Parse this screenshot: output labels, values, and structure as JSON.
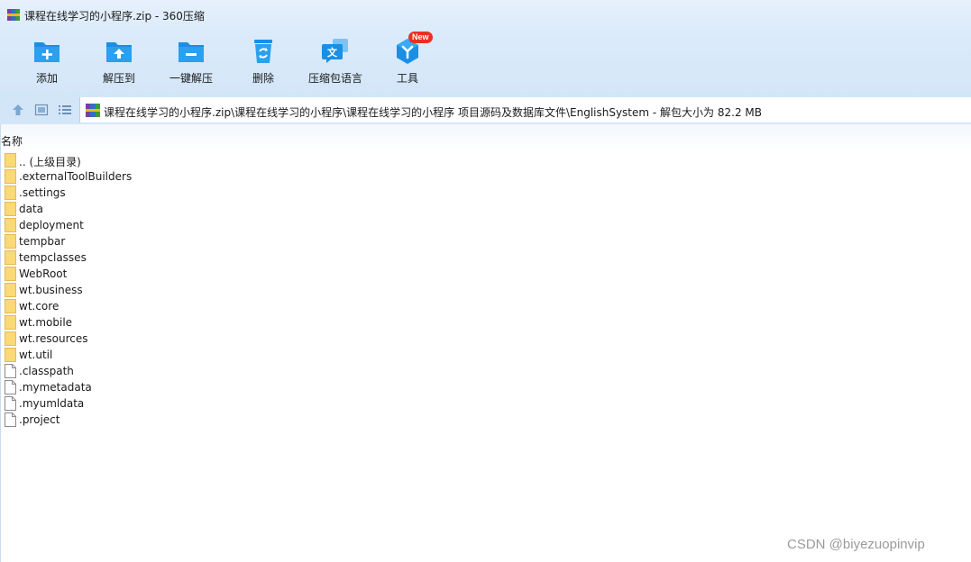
{
  "window": {
    "title": "课程在线学习的小程序.zip - 360压缩",
    "icon": "winrar-archive-icon"
  },
  "toolbar": {
    "tools": [
      {
        "label": "添加",
        "icon": "add-folder-icon"
      },
      {
        "label": "解压到",
        "icon": "extract-to-icon"
      },
      {
        "label": "一键解压",
        "icon": "one-click-extract-icon"
      },
      {
        "label": "删除",
        "icon": "recycle-bin-icon"
      },
      {
        "label": "压缩包语言",
        "icon": "archive-language-icon"
      },
      {
        "label": "工具",
        "icon": "tools-icon",
        "badge": "New"
      }
    ]
  },
  "addressbar": {
    "path": "课程在线学习的小程序.zip\\课程在线学习的小程序\\课程在线学习的小程序 项目源码及数据库文件\\EnglishSystem - 解包大小为 82.2 MB"
  },
  "filelist": {
    "column_name": "名称",
    "items": [
      {
        "name": ".. (上级目录)",
        "type": "folder"
      },
      {
        "name": ".externalToolBuilders",
        "type": "folder"
      },
      {
        "name": ".settings",
        "type": "folder"
      },
      {
        "name": "data",
        "type": "folder"
      },
      {
        "name": "deployment",
        "type": "folder"
      },
      {
        "name": "tempbar",
        "type": "folder"
      },
      {
        "name": "tempclasses",
        "type": "folder"
      },
      {
        "name": "WebRoot",
        "type": "folder"
      },
      {
        "name": "wt.business",
        "type": "folder"
      },
      {
        "name": "wt.core",
        "type": "folder"
      },
      {
        "name": "wt.mobile",
        "type": "folder"
      },
      {
        "name": "wt.resources",
        "type": "folder"
      },
      {
        "name": "wt.util",
        "type": "folder"
      },
      {
        "name": ".classpath",
        "type": "file"
      },
      {
        "name": ".mymetadata",
        "type": "file"
      },
      {
        "name": ".myumldata",
        "type": "file"
      },
      {
        "name": ".project",
        "type": "file"
      }
    ]
  },
  "watermark": "CSDN @biyezuopinvip",
  "colors": {
    "accent": "#1a8fe3",
    "folder": "#f9d978",
    "badge": "#e8311f"
  }
}
